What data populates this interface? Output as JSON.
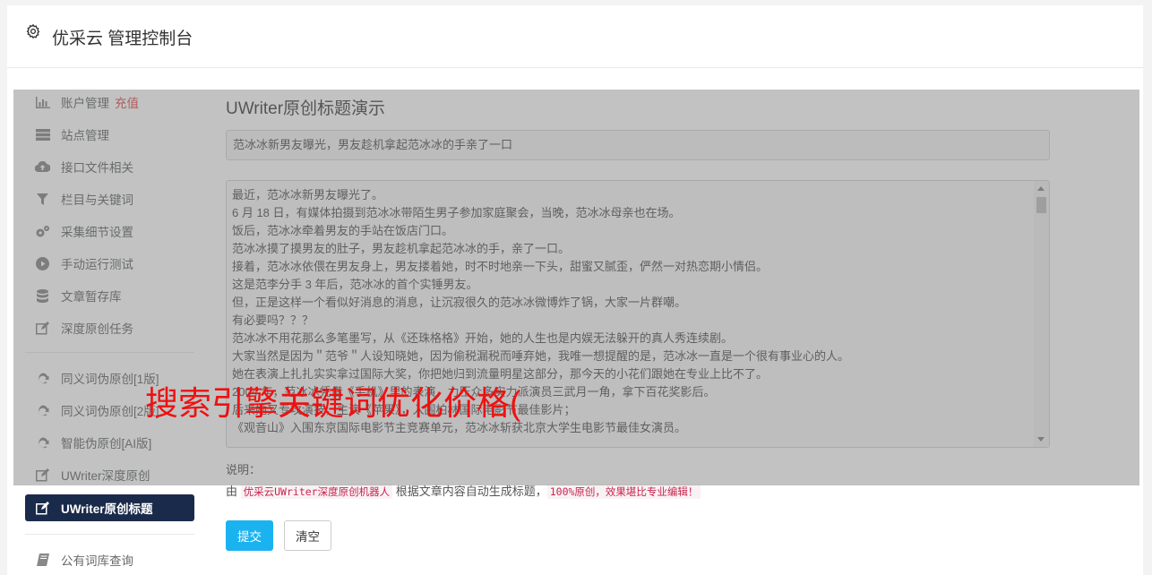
{
  "header": {
    "title": "优采云 管理控制台"
  },
  "sidebar": {
    "items": [
      {
        "label": "账户管理",
        "extra": "充值",
        "icon": "bar-chart-icon"
      },
      {
        "label": "站点管理",
        "icon": "server-icon"
      },
      {
        "label": "接口文件相关",
        "icon": "cloud-upload-icon"
      },
      {
        "label": "栏目与关键词",
        "icon": "filter-icon"
      },
      {
        "label": "采集细节设置",
        "icon": "cogs-icon"
      },
      {
        "label": "手动运行测试",
        "icon": "play-circle-icon"
      },
      {
        "label": "文章暂存库",
        "icon": "database-icon"
      },
      {
        "label": "深度原创任务",
        "icon": "edit-icon"
      }
    ],
    "items2": [
      {
        "label": "同义词伪原创[1版]",
        "icon": "refresh-icon"
      },
      {
        "label": "同义词伪原创[2版]",
        "icon": "refresh-icon"
      },
      {
        "label": "智能伪原创[AI版]",
        "icon": "refresh-icon"
      },
      {
        "label": "UWriter深度原创",
        "icon": "edit-icon"
      },
      {
        "label": "UWriter原创标题",
        "icon": "edit-icon",
        "active": true
      }
    ],
    "items3": [
      {
        "label": "公有词库查询",
        "icon": "book-icon"
      }
    ]
  },
  "main": {
    "title": "UWriter原创标题演示",
    "title_value": "范冰冰新男友曝光，男友趁机拿起范冰冰的手亲了一口",
    "article_lines": [
      "最近，范冰冰新男友曝光了。",
      "6 月 18 日，有媒体拍摄到范冰冰带陌生男子参加家庭聚会，当晚，范冰冰母亲也在场。",
      "饭后，范冰冰牵着男友的手站在饭店门口。",
      "范冰冰摸了摸男友的肚子，男友趁机拿起范冰冰的手，亲了一口。",
      "接着，范冰冰依偎在男友身上，男友搂着她，时不时地亲一下头，甜蜜又腻歪，俨然一对热恋期小情侣。",
      "这是范李分手 3 年后，范冰冰的首个实锤男友。",
      "但，正是这样一个看似好消息的消息，让沉寂很久的范冰冰微博炸了锅，大家一片群嘲。",
      "有必要吗？？？",
      "范冰冰不用花那么多笔墨写，从《还珠格格》开始，她的人生也是内娱无法躲开的真人秀连续剧。",
      "大家当然是因为＂范爷＂人设知晓她，因为偷税漏税而唾弃她，我唯一想提醒的是，范冰冰一直是一个很有事业心的人。",
      "她在表演上扎扎实实拿过国际大奖，你把她归到流量明星这部分，那今天的小花们跟她在专业上比不了。",
      "2004 年，范冰冰凭借《手机》里的表演，力压众多实力派演员三武月一角，拿下百花奖影后。",
      "后来她又专攻演技，主演《苹果》，入围柏林国际电影节最佳影片；",
      "《观音山》入围东京国际电影节主竞赛单元，范冰冰斩获北京大学生电影节最佳女演员。"
    ],
    "note_label": "说明：",
    "note_prefix": "由 ",
    "note_code1": "优采云UWriter深度原创机器人",
    "note_mid": " 根据文章内容自动生成标题，",
    "note_code2": "100%原创，效果堪比专业编辑！",
    "submit_label": "提交",
    "clear_label": "清空"
  },
  "watermark": "搜索引擎关键词优化价格("
}
